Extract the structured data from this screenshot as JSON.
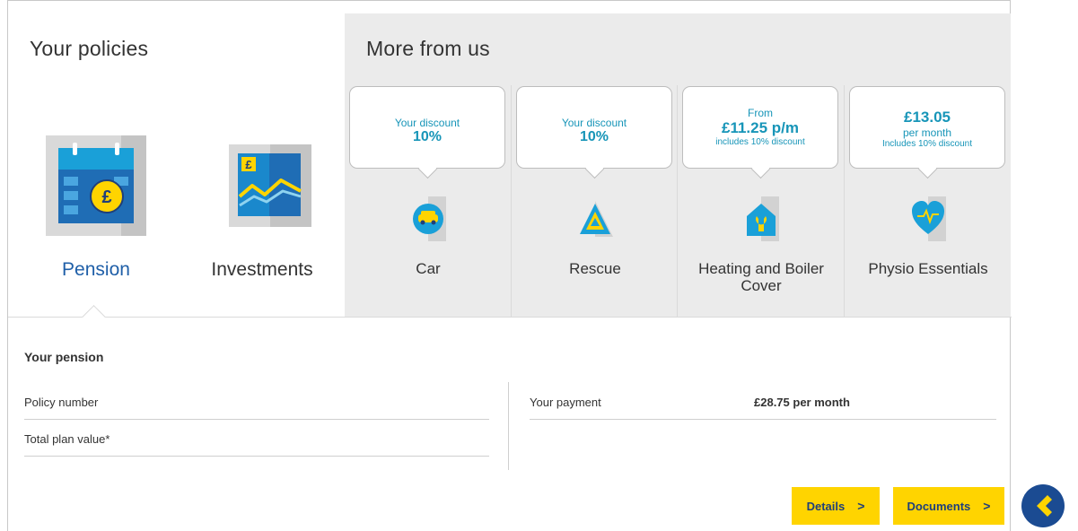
{
  "policies": {
    "title": "Your policies",
    "items": [
      {
        "label": "Pension"
      },
      {
        "label": "Investments"
      }
    ]
  },
  "more": {
    "title": "More from us",
    "offers": [
      {
        "line1": "Your discount",
        "line2": "10%",
        "line3": "",
        "label": "Car",
        "icon": "car-icon"
      },
      {
        "line1": "Your discount",
        "line2": "10%",
        "line3": "",
        "label": "Rescue",
        "icon": "rescue-triangle-icon"
      },
      {
        "line1": "From",
        "line2": "£11.25 p/m",
        "line3": "includes 10% discount",
        "label": "Heating and Boiler Cover",
        "icon": "home-wrench-icon"
      },
      {
        "line1": "£13.05",
        "line2": "per month",
        "line3": "Includes 10% discount",
        "label": "Physio Essentials",
        "icon": "heart-pulse-icon"
      }
    ]
  },
  "pension": {
    "title": "Your pension",
    "policy_number_label": "Policy number",
    "total_plan_value_label": "Total plan value*",
    "payment_label": "Your payment",
    "payment_value": "£28.75 per month"
  },
  "actions": {
    "details_label": "Details",
    "documents_label": "Documents",
    "chevron": ">"
  },
  "colors": {
    "accent_yellow": "#ffd400",
    "brand_blue": "#1f5fa8",
    "teal_text": "#1795b8",
    "panel_grey": "#ebebeb",
    "nav_blue": "#1b4b92"
  }
}
